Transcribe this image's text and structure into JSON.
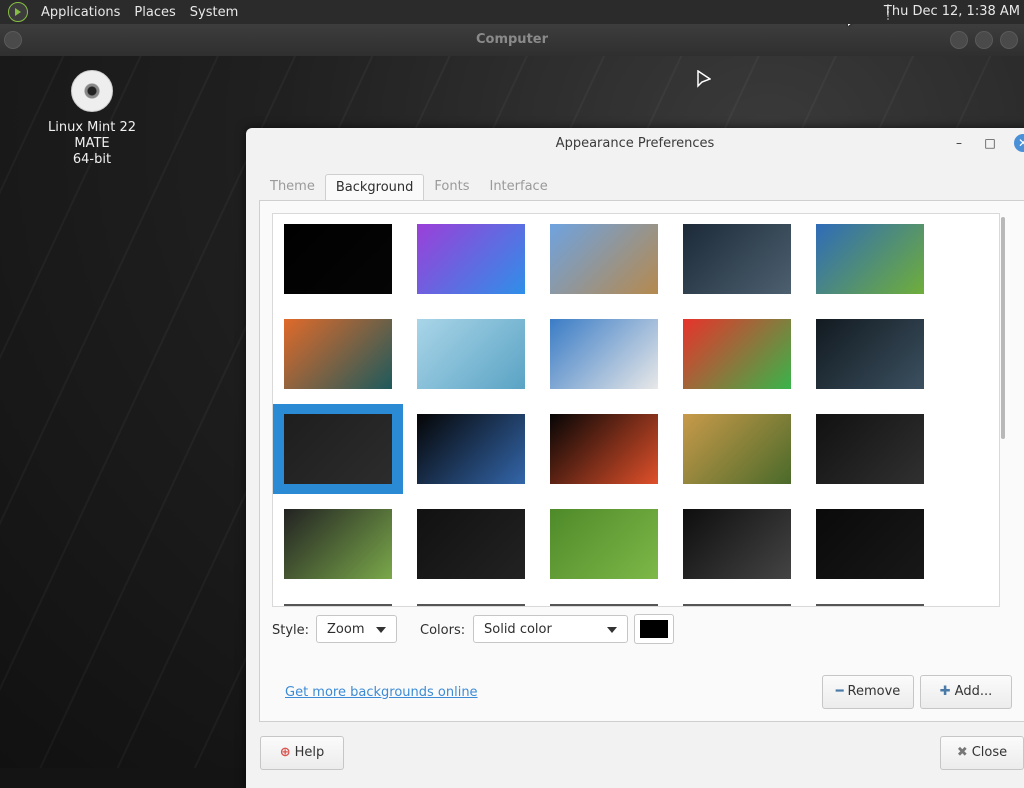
{
  "top_panel": {
    "menus": [
      "Applications",
      "Places",
      "System"
    ],
    "clock": "Thu Dec 12,  1:38 AM"
  },
  "background_window": {
    "title": "Computer"
  },
  "desktop_icon": {
    "line1": "Linux Mint 22 MATE",
    "line2": "64-bit"
  },
  "dialog": {
    "title": "Appearance Preferences",
    "minimize": "–",
    "maximize": "□",
    "close": "✕",
    "tabs": [
      "Theme",
      "Background",
      "Fonts",
      "Interface"
    ],
    "active_tab": "Background",
    "wallpapers": [
      {
        "name": "solid-black",
        "colors": [
          "#000000",
          "#050505"
        ]
      },
      {
        "name": "purple-waves",
        "colors": [
          "#9b3fd9",
          "#2f8fe8"
        ]
      },
      {
        "name": "lake-mountains",
        "colors": [
          "#6fa3e0",
          "#b5894e"
        ]
      },
      {
        "name": "dark-mountain",
        "colors": [
          "#1c2a38",
          "#4d6070"
        ]
      },
      {
        "name": "green-blue-pattern",
        "colors": [
          "#2f6bb8",
          "#6fae3a"
        ]
      },
      {
        "name": "orange-sunset-boat",
        "colors": [
          "#e06a2a",
          "#1d5a5c"
        ]
      },
      {
        "name": "misty-mountain",
        "colors": [
          "#a9d5e8",
          "#5aa3c4"
        ]
      },
      {
        "name": "snowy-valley",
        "colors": [
          "#3a7cc6",
          "#e8e8e8"
        ]
      },
      {
        "name": "rainbow-pencils",
        "colors": [
          "#e8322b",
          "#38b44a"
        ]
      },
      {
        "name": "circuit-chip",
        "colors": [
          "#121a20",
          "#3b5060"
        ]
      },
      {
        "name": "mint-logo-dark",
        "colors": [
          "#1e1e1e",
          "#2c2c2c"
        ]
      },
      {
        "name": "earth-space",
        "colors": [
          "#050505",
          "#3366aa"
        ]
      },
      {
        "name": "eclipse-sequence",
        "colors": [
          "#050505",
          "#e0502a"
        ]
      },
      {
        "name": "village-street",
        "colors": [
          "#c89a4a",
          "#4a6a2a"
        ]
      },
      {
        "name": "mint-logo-corner",
        "colors": [
          "#111111",
          "#303030"
        ]
      },
      {
        "name": "mint-green-layers",
        "colors": [
          "#222222",
          "#7aa84a"
        ]
      },
      {
        "name": "mint-logo-black",
        "colors": [
          "#111111",
          "#222222"
        ]
      },
      {
        "name": "mint-green",
        "colors": [
          "#4f8a2a",
          "#7db848"
        ]
      },
      {
        "name": "mint-logo-grey",
        "colors": [
          "#0e0e0e",
          "#444444"
        ]
      },
      {
        "name": "mint-logo-center",
        "colors": [
          "#0a0a0a",
          "#181818"
        ]
      }
    ],
    "selected_index": 10,
    "style_label": "Style:",
    "style_value": "Zoom",
    "colors_label": "Colors:",
    "colors_value": "Solid color",
    "color_swatch": "#000000",
    "more_link": "Get more backgrounds online",
    "remove_button": "Remove",
    "add_button": "Add...",
    "help_button": "Help",
    "close_button": "Close"
  }
}
